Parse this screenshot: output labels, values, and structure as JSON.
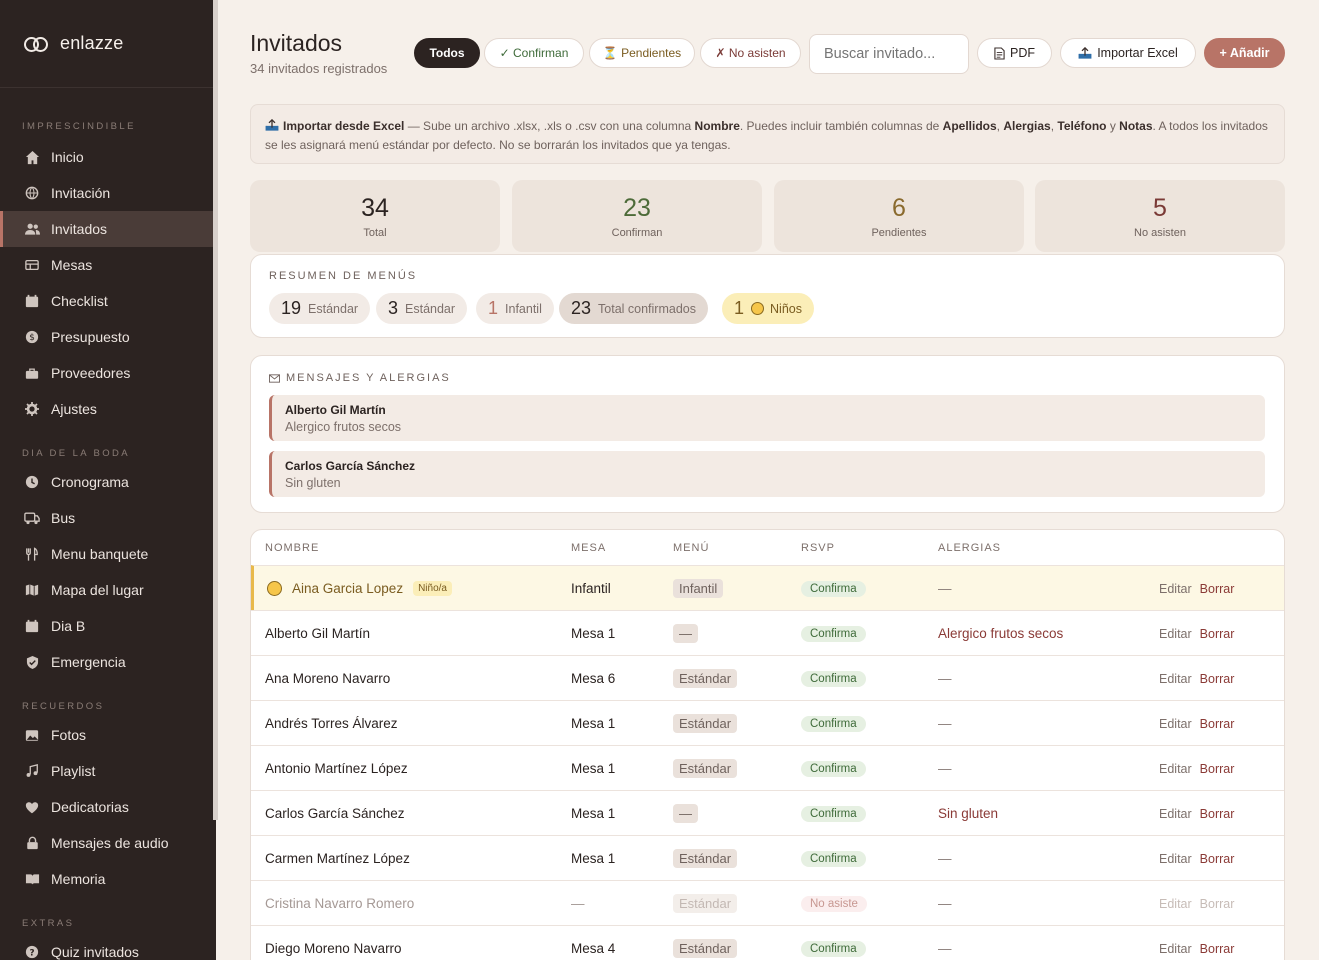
{
  "brand": {
    "name": "enlazze"
  },
  "sidebar": {
    "sections": [
      {
        "title": "IMPRESCINDIBLE",
        "items": [
          {
            "label": "Inicio",
            "icon": "home-icon"
          },
          {
            "label": "Invitación",
            "icon": "globe-icon"
          },
          {
            "label": "Invitados",
            "icon": "users-icon",
            "active": true
          },
          {
            "label": "Mesas",
            "icon": "table-icon"
          },
          {
            "label": "Checklist",
            "icon": "calendar-icon"
          },
          {
            "label": "Presupuesto",
            "icon": "coin-icon"
          },
          {
            "label": "Proveedores",
            "icon": "briefcase-icon"
          },
          {
            "label": "Ajustes",
            "icon": "gear-icon"
          }
        ]
      },
      {
        "title": "DIA DE LA BODA",
        "items": [
          {
            "label": "Cronograma",
            "icon": "clock-icon"
          },
          {
            "label": "Bus",
            "icon": "bus-icon"
          },
          {
            "label": "Menu banquete",
            "icon": "cutlery-icon"
          },
          {
            "label": "Mapa del lugar",
            "icon": "map-icon"
          },
          {
            "label": "Dia B",
            "icon": "calendar-icon"
          },
          {
            "label": "Emergencia",
            "icon": "shield-icon"
          }
        ]
      },
      {
        "title": "RECUERDOS",
        "items": [
          {
            "label": "Fotos",
            "icon": "image-icon"
          },
          {
            "label": "Playlist",
            "icon": "music-icon"
          },
          {
            "label": "Dedicatorias",
            "icon": "heart-icon"
          },
          {
            "label": "Mensajes de audio",
            "icon": "lock-icon"
          },
          {
            "label": "Memoria",
            "icon": "book-icon"
          }
        ]
      },
      {
        "title": "EXTRAS",
        "items": [
          {
            "label": "Quiz invitados",
            "icon": "question-icon"
          }
        ]
      }
    ]
  },
  "header": {
    "title": "Invitados",
    "subtitle": "34 invitados registrados",
    "filters": {
      "all": "Todos",
      "confirm": "✓ Confirman",
      "pending": "⏳ Pendientes",
      "declined": "✗ No asisten"
    },
    "search_placeholder": "Buscar invitado...",
    "pdf": "PDF",
    "import": "Importar Excel",
    "add": "+ Añadir"
  },
  "info": {
    "title": "Importar desde Excel",
    "text1": " — Sube un archivo .xlsx, .xls o .csv con una columna ",
    "name_col": "Nombre",
    "text2": ". Puedes incluir también columnas de ",
    "col_apellidos": "Apellidos",
    "col_alergias": "Alergias",
    "col_telefono": "Teléfono",
    "and": " y ",
    "col_notas": "Notas",
    "text3": ". A todos los invitados se les asignará menú estándar por defecto. No se borrarán los invitados que ya tengas."
  },
  "stats": [
    {
      "value": "34",
      "label": "Total",
      "color": "#2b2321"
    },
    {
      "value": "23",
      "label": "Confirman",
      "color": "#4d6b39"
    },
    {
      "value": "6",
      "label": "Pendientes",
      "color": "#8a6a2e"
    },
    {
      "value": "5",
      "label": "No asisten",
      "color": "#7a3a36"
    }
  ],
  "menus": {
    "title": "RESUMEN DE MENÚS",
    "pills": [
      {
        "n": "19",
        "label": "Estándar"
      },
      {
        "n": "3",
        "label": "Estándar"
      },
      {
        "n": "1",
        "label": "Infantil"
      },
      {
        "n": "23",
        "label": "Total confirmados"
      },
      {
        "n": "1",
        "label": "Niños"
      }
    ]
  },
  "messages": {
    "title": "MENSAJES Y ALERGIAS",
    "items": [
      {
        "name": "Alberto Gil Martín",
        "text": "Alergico frutos secos"
      },
      {
        "name": "Carlos García Sánchez",
        "text": "Sin gluten"
      }
    ]
  },
  "table": {
    "headers": {
      "name": "NOMBRE",
      "mesa": "MESA",
      "menu": "MENÚ",
      "rsvp": "RSVP",
      "alergias": "ALERGIAS"
    },
    "edit": "Editar",
    "delete": "Borrar",
    "kid_badge": "Niño/a",
    "rows": [
      {
        "name": "Aina Garcia Lopez",
        "mesa": "Infantil",
        "menu": "Infantil",
        "rsvp": "Confirma",
        "alergia": "—"
      },
      {
        "name": "Alberto Gil Martín",
        "mesa": "Mesa 1",
        "menu": "—",
        "rsvp": "Confirma",
        "alergia": "Alergico frutos secos"
      },
      {
        "name": "Ana Moreno Navarro",
        "mesa": "Mesa 6",
        "menu": "Estándar",
        "rsvp": "Confirma",
        "alergia": "—"
      },
      {
        "name": "Andrés Torres Álvarez",
        "mesa": "Mesa 1",
        "menu": "Estándar",
        "rsvp": "Confirma",
        "alergia": "—"
      },
      {
        "name": "Antonio Martínez López",
        "mesa": "Mesa 1",
        "menu": "Estándar",
        "rsvp": "Confirma",
        "alergia": "—"
      },
      {
        "name": "Carlos García Sánchez",
        "mesa": "Mesa 1",
        "menu": "—",
        "rsvp": "Confirma",
        "alergia": "Sin gluten"
      },
      {
        "name": "Carmen Martínez López",
        "mesa": "Mesa 1",
        "menu": "Estándar",
        "rsvp": "Confirma",
        "alergia": "—"
      },
      {
        "name": "Cristina Navarro Romero",
        "mesa": "—",
        "menu": "Estándar",
        "rsvp": "No asiste",
        "alergia": "—"
      },
      {
        "name": "Diego Moreno Navarro",
        "mesa": "Mesa 4",
        "menu": "Estándar",
        "rsvp": "Confirma",
        "alergia": "—"
      }
    ]
  }
}
